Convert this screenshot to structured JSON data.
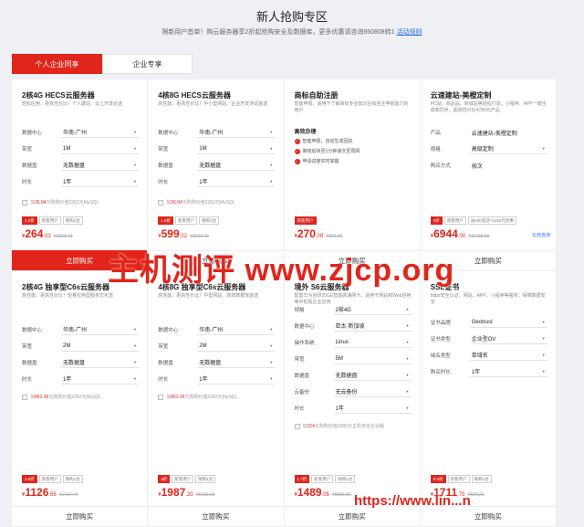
{
  "page": {
    "title": "新人抢购专区",
    "subtitle": "限新用户首单！购云服务器享2折起抢购安全及数据库，更多优惠请咨询950808转1",
    "subtitle_link": "活动规则"
  },
  "tabs": [
    {
      "label": "个人企业同享",
      "active": true
    },
    {
      "label": "企业专享",
      "active": false
    }
  ],
  "cards": [
    {
      "name": "2核4G HECS云服务器",
      "desc": "轻松应用、更高性价比！个人建站、云上开发必选",
      "fields": [
        {
          "label": "数据中心",
          "value": "华南-广州"
        },
        {
          "label": "带宽",
          "value": "1M"
        },
        {
          "label": "数据盘",
          "value": "无数据盘"
        },
        {
          "label": "时长",
          "value": "1年"
        }
      ],
      "promo_prefix": "加",
      "promo_price": "36.04",
      "promo_suffix": "元购购价值2362元MySQL",
      "badges": [
        {
          "text": "1.2折",
          "red": true
        },
        {
          "text": "新客用户",
          "red": false
        },
        {
          "text": "限购1台",
          "red": false
        }
      ],
      "price_int": "264",
      "price_dec": ".03",
      "price_orig": "¥1833.43",
      "buy_label": "立即购买",
      "buy_active": true
    },
    {
      "name": "4核8G HECS云服务器",
      "desc": "高性能、更高性价比！中小型网站、企业开发测试首选",
      "fields": [
        {
          "label": "数据中心",
          "value": "华南-广州"
        },
        {
          "label": "带宽",
          "value": "1M"
        },
        {
          "label": "数据盘",
          "value": "无数据盘"
        },
        {
          "label": "时长",
          "value": "1年"
        }
      ],
      "promo_prefix": "加",
      "promo_price": "36.04",
      "promo_suffix": "元购购价值2362元MySQL",
      "badges": [
        {
          "text": "1.6折",
          "red": true
        },
        {
          "text": "新客用户",
          "red": false
        },
        {
          "text": "限购1台",
          "red": false
        }
      ],
      "price_int": "599",
      "price_dec": ".02",
      "price_orig": "¥3121.42",
      "buy_label": "立即购买",
      "buy_active": false
    },
    {
      "name": "商标自助注册",
      "desc": "智能申报，适用于了解商标专业知识且有自主申报能力的用户",
      "list_title": "高效办理",
      "list": [
        "智能申报，自动生成回执",
        "审核后快至1分钟递交至局网",
        "申请进度实时掌握"
      ],
      "badges": [
        {
          "text": "新客用户",
          "red": true
        }
      ],
      "price_int": "270",
      "price_dec": ".00",
      "price_orig": "¥300.00",
      "buy_label": "立即购买",
      "buy_active": false
    },
    {
      "name": "云速建站-美橙定制",
      "desc": "PC站、商品站、商城站等轻松打造，小程序、APP一键生成和同步，超高性价比4780元产品",
      "fields": [
        {
          "label": "产品",
          "value": "云速建站-美橙定制",
          "plain": true
        },
        {
          "label": "规格",
          "value": "高级定制"
        },
        {
          "label": "购买方式",
          "value": "按次",
          "plain": true
        }
      ],
      "badges": [
        {
          "text": "5折",
          "red": true
        },
        {
          "text": "新客用户",
          "red": false
        },
        {
          "text": "送400电话+1200元优惠",
          "red": false
        }
      ],
      "price_int": "6944",
      "price_dec": ".00",
      "price_orig": "¥11738.00",
      "service_link": "云商咨询",
      "buy_label": "立即购买",
      "buy_active": false
    },
    {
      "name": "2核4G 独享型C6s云服务器",
      "desc": "高性能、更高性价比！轻量应用型服务优化选",
      "fields": [
        {
          "label": "数据中心",
          "value": "华南-广州"
        },
        {
          "label": "带宽",
          "value": "2M"
        },
        {
          "label": "数据盘",
          "value": "无数据盘"
        },
        {
          "label": "时长",
          "value": "1年"
        }
      ],
      "promo_prefix": "加",
      "promo_price": "862.06",
      "promo_suffix": "元购购价值2362元MySQL",
      "badges": [
        {
          "text": "3.9折",
          "red": true
        },
        {
          "text": "新客用户",
          "red": false
        },
        {
          "text": "限购1台",
          "red": false
        }
      ],
      "price_int": "1126",
      "price_dec": ".56",
      "price_orig": "¥1717.44",
      "buy_label": "立即购买",
      "buy_active": false
    },
    {
      "name": "4核8G 独享型C6s云服务器",
      "desc": "高性能、更高性价比！中型网站、高效数据库首选",
      "fields": [
        {
          "label": "数据中心",
          "value": "华南-广州"
        },
        {
          "label": "带宽",
          "value": "2M"
        },
        {
          "label": "数据盘",
          "value": "无数据盘"
        },
        {
          "label": "时长",
          "value": "1年"
        }
      ],
      "promo_prefix": "加",
      "promo_price": "862.06",
      "promo_suffix": "元购购价值2362元MySQL",
      "badges": [
        {
          "text": "4折",
          "red": true
        },
        {
          "text": "新客用户",
          "red": false
        },
        {
          "text": "限购1台",
          "red": false
        }
      ],
      "price_int": "1987",
      "price_dec": ".20",
      "price_orig": "¥5000.00",
      "buy_label": "立即购买",
      "buy_active": false
    },
    {
      "name": "境外 S6云服务器",
      "desc": "配置华为自研25GE智能高速网卡，适用于网站和Web应用等中轻载企业应用",
      "fields": [
        {
          "label": "规格",
          "value": "2核4G"
        },
        {
          "label": "数据中心",
          "value": "亚太-新加坡"
        },
        {
          "label": "操作系统",
          "value": "Linux"
        },
        {
          "label": "带宽",
          "value": "5M"
        },
        {
          "label": "数据盘",
          "value": "无数据盘"
        },
        {
          "label": "云备份",
          "value": "无云备份"
        },
        {
          "label": "时长",
          "value": "1年"
        }
      ],
      "promo_prefix": "加",
      "promo_price": "324",
      "promo_suffix": "元购购价值1080元主机安全企业版",
      "badges": [
        {
          "text": "1.7折",
          "red": true
        },
        {
          "text": "新客用户",
          "red": false
        },
        {
          "text": "限购1台",
          "red": false
        }
      ],
      "price_int": "1489",
      "price_dec": ".05",
      "price_orig": "¥8656.80",
      "buy_label": "立即购买",
      "buy_active": false
    },
    {
      "name": "SSL证书",
      "desc": "https安全认证，网站、APP、小程序等服务，保障数据安全",
      "fields": [
        {
          "label": "证书品牌",
          "value": "Geotrust"
        },
        {
          "label": "证书类型",
          "value": "企业型OV"
        },
        {
          "label": "域名类型",
          "value": "单域名"
        },
        {
          "label": "购买时长",
          "value": "1年"
        }
      ],
      "badges": [
        {
          "text": "8.6折",
          "red": true
        },
        {
          "text": "新客用户",
          "red": false
        },
        {
          "text": "限购1台",
          "red": false
        }
      ],
      "price_int": "1711",
      "price_dec": ".75",
      "price_orig": "¥699.21",
      "buy_label": "立即购买",
      "buy_active": false
    }
  ],
  "watermarks": {
    "main": "主机测评 www.zjcp.org",
    "corner": "https://www.lin...n"
  },
  "colors": {
    "accent": "#e1251b",
    "link": "#2b6de8",
    "background": "#eef0f4"
  }
}
